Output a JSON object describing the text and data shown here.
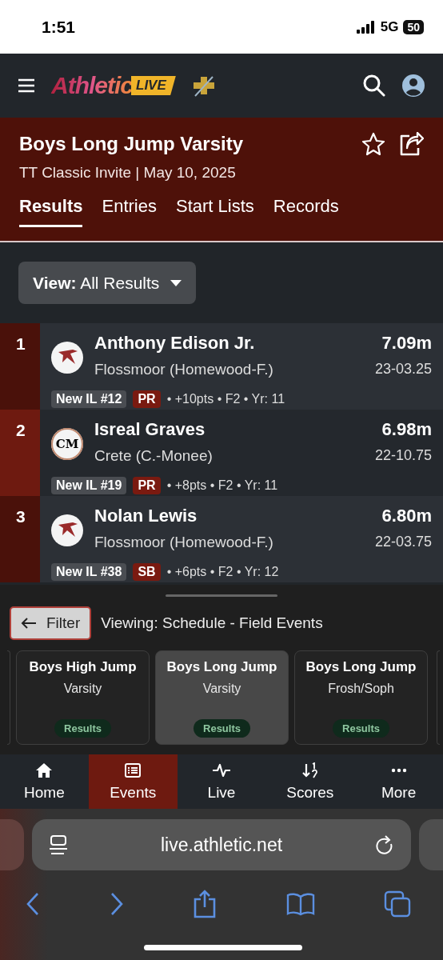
{
  "status_bar": {
    "time": "1:51",
    "network": "5G",
    "battery": "50"
  },
  "app_bar": {
    "logo": {
      "word": "Athletic",
      "badge": "LIVE"
    }
  },
  "event_header": {
    "title": "Boys Long Jump Varsity",
    "subtitle": "TT Classic Invite | May 10, 2025",
    "tabs": [
      {
        "label": "Results",
        "selected": true
      },
      {
        "label": "Entries",
        "selected": false
      },
      {
        "label": "Start Lists",
        "selected": false
      },
      {
        "label": "Records",
        "selected": false
      }
    ]
  },
  "view_dropdown": {
    "label": "View:",
    "value": "All Results"
  },
  "results": [
    {
      "place": "1",
      "name": "Anthony Edison Jr.",
      "team": "Flossmoor (Homewood-F.)",
      "mark": "7.09m",
      "imperial": "23-03.25",
      "logo": {
        "kind": "bird"
      },
      "badges": [
        {
          "kind": "rank",
          "text": "New IL #12"
        },
        {
          "kind": "best",
          "text": "PR"
        }
      ],
      "meta": "• +10pts • F2 • Yr: 11"
    },
    {
      "place": "2",
      "name": "Isreal Graves",
      "team": "Crete (C.-Monee)",
      "mark": "6.98m",
      "imperial": "22-10.75",
      "logo": {
        "kind": "monogram",
        "text": "CM"
      },
      "badges": [
        {
          "kind": "rank",
          "text": "New IL #19"
        },
        {
          "kind": "best",
          "text": "PR"
        }
      ],
      "meta": "• +8pts • F2 • Yr: 11"
    },
    {
      "place": "3",
      "name": "Nolan Lewis",
      "team": "Flossmoor (Homewood-F.)",
      "mark": "6.80m",
      "imperial": "22-03.75",
      "logo": {
        "kind": "bird"
      },
      "badges": [
        {
          "kind": "rank",
          "text": "New IL #38"
        },
        {
          "kind": "best",
          "text": "SB"
        }
      ],
      "meta": "• +6pts • F2 • Yr: 12"
    }
  ],
  "schedule_sheet": {
    "filter_button": "Filter",
    "viewing": "Viewing: Schedule - Field Events",
    "events": [
      {
        "title": "Boys High Jump",
        "division": "Varsity",
        "status": "Results",
        "selected": false
      },
      {
        "title": "Boys Long Jump",
        "division": "Varsity",
        "status": "Results",
        "selected": true
      },
      {
        "title": "Boys Long Jump",
        "division": "Frosh/Soph",
        "status": "Results",
        "selected": false
      }
    ]
  },
  "bottom_nav": [
    {
      "label": "Home",
      "selected": false
    },
    {
      "label": "Events",
      "selected": true
    },
    {
      "label": "Live",
      "selected": false
    },
    {
      "label": "Scores",
      "selected": false
    },
    {
      "label": "More",
      "selected": false
    }
  ],
  "browser": {
    "url": "live.athletic.net"
  }
}
